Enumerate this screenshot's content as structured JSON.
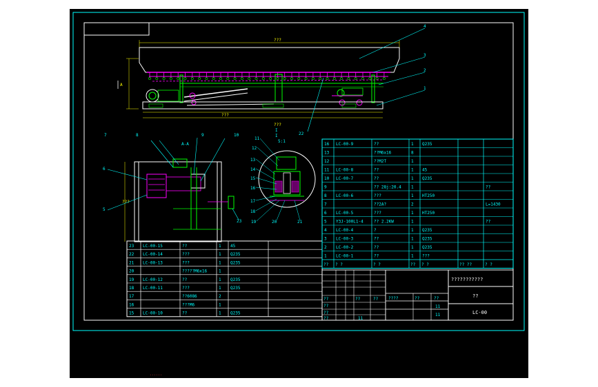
{
  "drawing": {
    "main_view_title": "???",
    "dimension_top": "???",
    "dimension_bottom": "???",
    "dimension_left": "???",
    "section_marker": "A",
    "section_view_title": "A-A",
    "detail_label": "I",
    "detail_scale": "5:1"
  },
  "callouts": {
    "main": [
      "4",
      "3",
      "2",
      "1",
      "22"
    ],
    "section": [
      "7",
      "8",
      "9",
      "10",
      "6",
      "5",
      "23"
    ],
    "detail": [
      "11",
      "12",
      "13",
      "14",
      "15",
      "16",
      "17",
      "18",
      "19",
      "20",
      "21"
    ]
  },
  "bom_right": [
    {
      "no": "16",
      "code": "LC-00-9",
      "name": "??",
      "qty": "1",
      "mat": "Q235",
      "note": ""
    },
    {
      "no": "13",
      "code": "",
      "name": "??M6x16",
      "qty": "8",
      "mat": "",
      "note": ""
    },
    {
      "no": "12",
      "code": "",
      "name": "??M2T",
      "qty": "1",
      "mat": "",
      "note": ""
    },
    {
      "no": "11",
      "code": "LC-00-8",
      "name": "??",
      "qty": "1",
      "mat": "45",
      "note": ""
    },
    {
      "no": "10",
      "code": "LC-00-7",
      "name": "??",
      "qty": "1",
      "mat": "Q235",
      "note": ""
    },
    {
      "no": "9",
      "code": "",
      "name": "??  28j:20.4",
      "qty": "1",
      "mat": "",
      "note": "??"
    },
    {
      "no": "8",
      "code": "LC-00-6",
      "name": "???",
      "qty": "1",
      "mat": "HT250",
      "note": ""
    },
    {
      "no": "7",
      "code": "",
      "name": "??2A?",
      "qty": "2",
      "mat": "",
      "note": "L=1430"
    },
    {
      "no": "6",
      "code": "LC-00-5",
      "name": "???",
      "qty": "1",
      "mat": "HT250",
      "note": ""
    },
    {
      "no": "5",
      "code": "Y3J-100L1-4",
      "name": "??   2.2KW",
      "qty": "1",
      "mat": "",
      "note": "??"
    },
    {
      "no": "4",
      "code": "LC-00-4",
      "name": "?",
      "qty": "1",
      "mat": "Q235",
      "note": ""
    },
    {
      "no": "3",
      "code": "LC-00-3",
      "name": "??",
      "qty": "1",
      "mat": "Q235",
      "note": ""
    },
    {
      "no": "2",
      "code": "LC-00-2",
      "name": "??",
      "qty": "1",
      "mat": "Q235",
      "note": ""
    },
    {
      "no": "1",
      "code": "LC-00-1",
      "name": "??",
      "qty": "1",
      "mat": "???",
      "note": ""
    }
  ],
  "bom_right_header": [
    "??",
    "?  ?",
    "?  ?",
    "??",
    "?  ?",
    "?? ??",
    "?  ?"
  ],
  "bom_left": [
    {
      "no": "23",
      "code": "LC-00-15",
      "name": "??",
      "qty": "1",
      "mat": "45"
    },
    {
      "no": "22",
      "code": "LC-00-14",
      "name": "???",
      "qty": "1",
      "mat": "Q235"
    },
    {
      "no": "21",
      "code": "LC-00-13",
      "name": "???",
      "qty": "1",
      "mat": "Q235"
    },
    {
      "no": "20",
      "code": "",
      "name": "?????M6x16",
      "qty": "1",
      "mat": ""
    },
    {
      "no": "19",
      "code": "LC-00-12",
      "name": "??",
      "qty": "1",
      "mat": "Q235"
    },
    {
      "no": "18",
      "code": "LC-00-11",
      "name": "???",
      "qty": "1",
      "mat": "Q235"
    },
    {
      "no": "17",
      "code": "",
      "name": "??6086",
      "qty": "2",
      "mat": ""
    },
    {
      "no": "16",
      "code": "",
      "name": "???M6",
      "qty": "1",
      "mat": ""
    },
    {
      "no": "15",
      "code": "LC-00-10",
      "name": "??",
      "qty": "1",
      "mat": "Q235"
    }
  ],
  "title_block": {
    "drawing_name": "???????????",
    "company": "??",
    "drawing_no": "LC-00",
    "mid_labels": [
      "????",
      "??",
      "??"
    ],
    "mid_values": [
      "",
      "11",
      "11"
    ],
    "sign_rows": [
      "??",
      "??",
      "??",
      "??"
    ],
    "sign_extra": [
      "??",
      "??",
      "11"
    ]
  },
  "footer_note": "......",
  "colors": {
    "background": "#000000",
    "frame": "#00ffff",
    "main_part": "#00ff00",
    "accent": "#ff00ff",
    "text": "#ffffff",
    "dimension": "#ffff00"
  }
}
